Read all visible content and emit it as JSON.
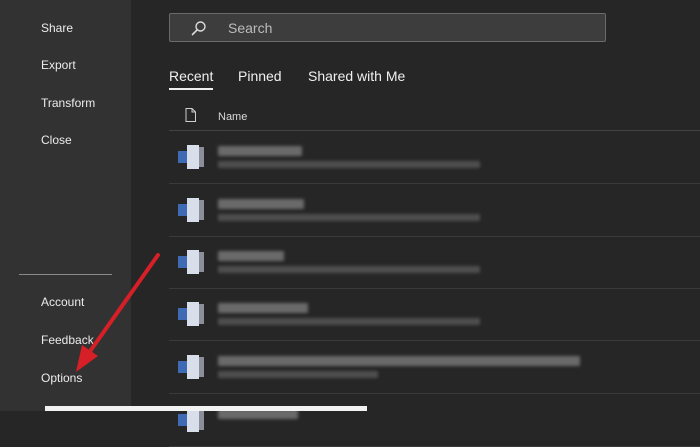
{
  "sidebar": {
    "items": [
      {
        "label": "Share"
      },
      {
        "label": "Export"
      },
      {
        "label": "Transform"
      },
      {
        "label": "Close"
      }
    ],
    "bottom_items": [
      {
        "label": "Account"
      },
      {
        "label": "Feedback"
      },
      {
        "label": "Options"
      }
    ]
  },
  "search": {
    "placeholder": "Search"
  },
  "tabs": [
    {
      "label": "Recent",
      "active": true
    },
    {
      "label": "Pinned"
    },
    {
      "label": "Shared with Me"
    }
  ],
  "file_list": {
    "column_header": "Name"
  },
  "colors": {
    "annotation_arrow": "#d61f26",
    "word_blue": "#3f6bb5"
  }
}
